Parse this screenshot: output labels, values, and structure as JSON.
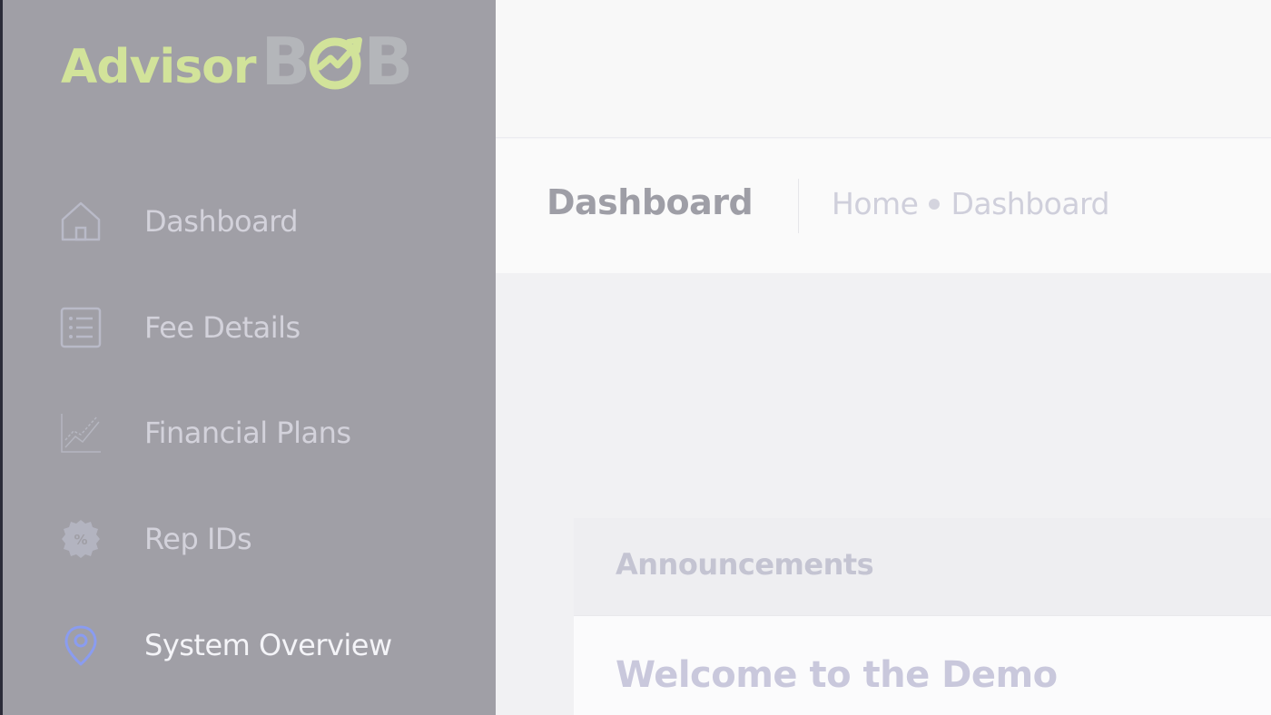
{
  "brand": {
    "name_part1": "Advisor",
    "name_part2_left": "B",
    "name_part2_right": "B",
    "accent_green": "#d2e39a",
    "logo_gray": "#b4b6ba"
  },
  "sidebar": {
    "items": [
      {
        "label": "Dashboard",
        "icon": "home-icon",
        "active": false
      },
      {
        "label": "Fee Details",
        "icon": "list-document-icon",
        "active": false
      },
      {
        "label": "Financial Plans",
        "icon": "line-chart-icon",
        "active": false
      },
      {
        "label": "Rep IDs",
        "icon": "percent-badge-icon",
        "active": false
      },
      {
        "label": "System Overview",
        "icon": "map-pin-icon",
        "active": true
      }
    ],
    "active_icon_color": "#8a9cf0"
  },
  "header": {
    "title": "Dashboard",
    "breadcrumb": [
      "Home",
      "Dashboard"
    ]
  },
  "announcements": {
    "title": "Announcements",
    "headline": "Welcome to the Demo"
  }
}
